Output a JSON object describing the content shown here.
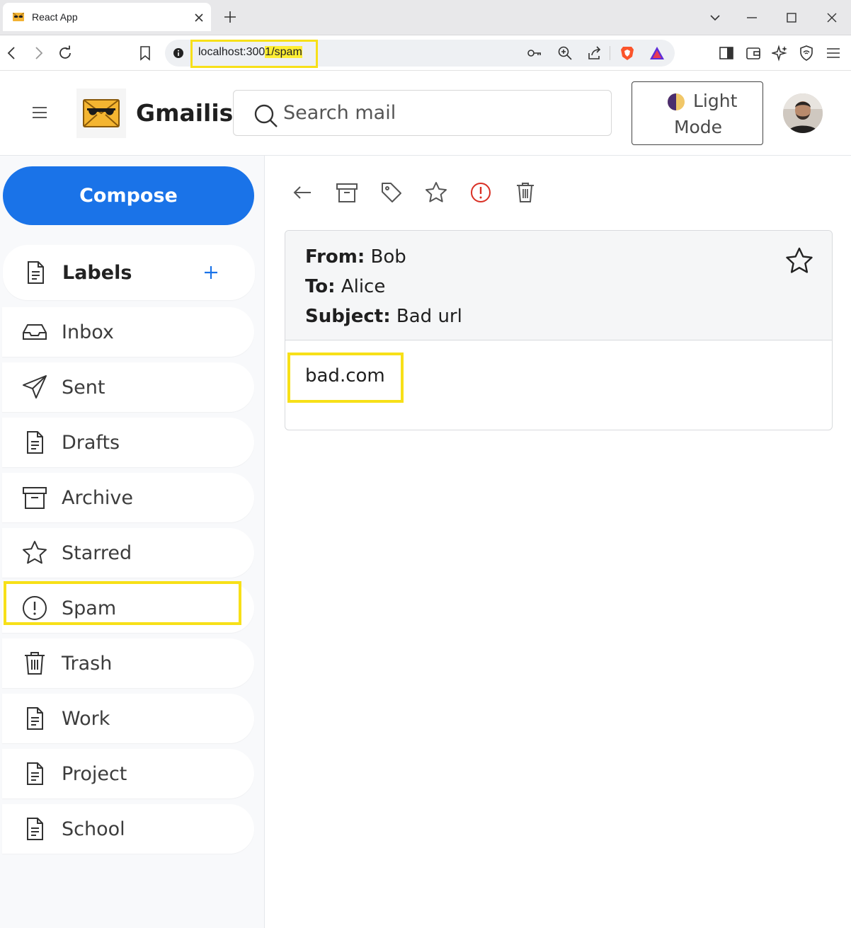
{
  "browser": {
    "tab_title": "React App",
    "url_host": "localhost:300",
    "url_path": "1/spam"
  },
  "header": {
    "brand": "Gmailish",
    "search_placeholder": "Search mail",
    "mode_line1": "Light",
    "mode_line2": "Mode"
  },
  "sidebar": {
    "compose_label": "Compose",
    "labels_heading": "Labels",
    "items": [
      {
        "label": "Inbox",
        "icon": "inbox-icon"
      },
      {
        "label": "Sent",
        "icon": "send-icon"
      },
      {
        "label": "Drafts",
        "icon": "file-icon"
      },
      {
        "label": "Archive",
        "icon": "archive-icon"
      },
      {
        "label": "Starred",
        "icon": "star-icon"
      },
      {
        "label": "Spam",
        "icon": "alert-circle-icon",
        "active": true
      },
      {
        "label": "Trash",
        "icon": "trash-icon"
      },
      {
        "label": "Work",
        "icon": "file-icon"
      },
      {
        "label": "Project",
        "icon": "file-icon"
      },
      {
        "label": "School",
        "icon": "file-icon"
      }
    ]
  },
  "mail": {
    "from_label": "From:",
    "from": "Bob",
    "to_label": "To:",
    "to": "Alice",
    "subject_label": "Subject:",
    "subject": "Bad url",
    "body": "bad.com"
  },
  "colors": {
    "accent": "#1a73e8",
    "highlight": "#f7e018",
    "spam_red": "#d93025"
  }
}
